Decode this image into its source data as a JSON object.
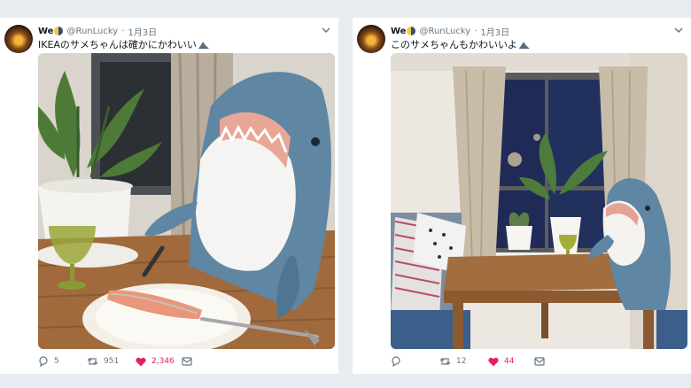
{
  "tweets": [
    {
      "name": "We",
      "handle": "@RunLucky",
      "separator": "·",
      "date": "1月3日",
      "text": "IKEAのサメちゃんは確かにかわいい",
      "replies": "5",
      "retweets": "951",
      "likes": "2,346"
    },
    {
      "name": "We",
      "handle": "@RunLucky",
      "separator": "·",
      "date": "1月3日",
      "text": "このサメちゃんもかわいいよ",
      "replies": "",
      "retweets": "12",
      "likes": "44"
    }
  ],
  "icons": {
    "avatar": "avatar-image",
    "name_emoji": "moon-icon",
    "text_emoji": "shark-fin-icon",
    "menu": "chevron-down-icon",
    "reply": "reply-icon",
    "retweet": "retweet-icon",
    "like": "heart-icon",
    "dm": "message-icon"
  },
  "colors": {
    "background": "#e6ecf0",
    "card": "#ffffff",
    "text": "#14171a",
    "muted": "#657786",
    "like": "#e0245e"
  }
}
